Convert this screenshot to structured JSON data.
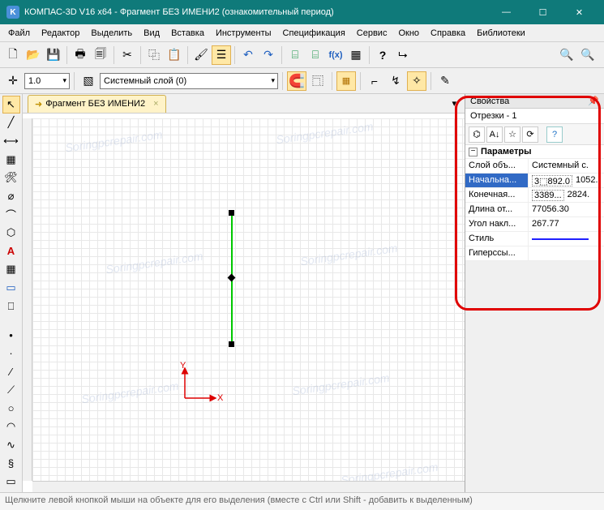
{
  "titlebar": {
    "icon_letter": "K",
    "title": "КОМПАС-3D V16  x64 - Фрагмент БЕЗ ИМЕНИ2 (ознакомительный период)",
    "min": "—",
    "max": "☐",
    "close": "✕"
  },
  "menu": [
    "Файл",
    "Редактор",
    "Выделить",
    "Вид",
    "Вставка",
    "Инструменты",
    "Спецификация",
    "Сервис",
    "Окно",
    "Справка",
    "Библиотеки"
  ],
  "tb": {
    "newdoc": "🗋",
    "open": "📂",
    "save": "💾",
    "print": "🖶",
    "preview": "🗐",
    "cut": "✂",
    "copy": "⿻",
    "paste": "📋",
    "brush": "🖌",
    "props": "☰",
    "undo": "↶",
    "redo": "↷",
    "lib1": "⌸",
    "lib2": "⌸",
    "fx": "f(x)",
    "vars": "▦",
    "help": "?",
    "arrow": "⮡",
    "zoomin": "🔍",
    "zoomfit": "🔍"
  },
  "tb2": {
    "snap": "✛",
    "scale_value": "1.0",
    "layers": "▧",
    "layer_name": "Системный слой (0)",
    "magnet": "🧲",
    "fit": "⿹",
    "grid": "▦",
    "ortho": "⌐",
    "bezier": "↯",
    "auto": "✧",
    "pen": "✎"
  },
  "tools": {
    "arrow": "↖",
    "line": "╱",
    "dim": "⟷",
    "hatch": "▦",
    "edit": "🛠",
    "param": "⌀",
    "arc": "⌒",
    "poly": "⬡",
    "a_text": "А",
    "table": "▦",
    "screen": "▭",
    "stamp": "⎕",
    "pt1": "•",
    "pt2": "·",
    "l1": "∕",
    "l2": "⟋",
    "circ": "○",
    "carc": "◠",
    "wave": "∿",
    "curve": "§",
    "rect": "▭"
  },
  "doctab": {
    "icon": "➜",
    "label": "Фрагмент БЕЗ ИМЕНИ2",
    "close": "×",
    "menu": "▾"
  },
  "axis": {
    "x": "X",
    "y": "Y"
  },
  "watermark": "Soringpcrepair.com",
  "props": {
    "title": "Свойства",
    "pin": "📌",
    "subtitle": "Отрезки - 1",
    "toolbtns": {
      "b1": "⌬",
      "b2": "A↓",
      "b3": "☆",
      "b4": "⟳",
      "help": "?"
    },
    "group": "Параметры",
    "rows": [
      {
        "k": "Слой объ...",
        "v": "Системный с."
      },
      {
        "k": "Начальна...",
        "v1": "3⬚892.0",
        "v2": "1052.",
        "selected": true
      },
      {
        "k": "Конечная...",
        "v1": "3389...",
        "v2": "2824."
      },
      {
        "k": "Длина от...",
        "v": "77056.30"
      },
      {
        "k": "Угол накл...",
        "v": "267.77"
      },
      {
        "k": "Стиль",
        "style": true
      },
      {
        "k": "Гиперссы...",
        "v": ""
      }
    ]
  },
  "status": "Щелкните левой кнопкой мыши на объекте для его выделения (вместе с Ctrl или Shift - добавить к выделенным)"
}
